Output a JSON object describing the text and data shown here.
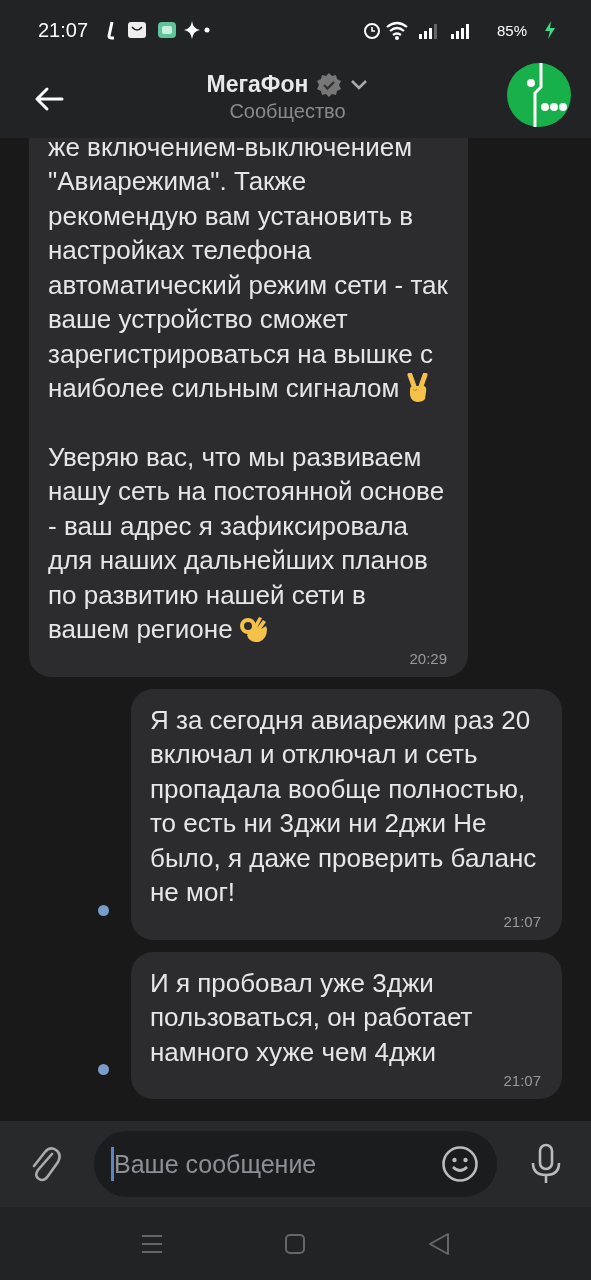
{
  "status_bar": {
    "time": "21:07",
    "battery": "85%"
  },
  "header": {
    "title": "МегаФон",
    "verified": true,
    "subtitle": "Сообщество"
  },
  "messages": [
    {
      "kind": "incoming",
      "unread": false,
      "paragraphs": [
        {
          "text": "же включением-выключением \"Авиарежима\". Также рекомендую вам установить в настройках телефона автоматический режим сети - так ваше устройство сможет зарегистрироваться на вышке с наиболее сильным сигналом",
          "kind": "victory"
        },
        {
          "text": "Уверяю вас, что мы развиваем нашу сеть на постоянной основе - ваш адрес я зафиксировала для наших дальнейших планов по развитию нашей сети в вашем регионе",
          "kind": "ok"
        }
      ],
      "time": "20:29"
    },
    {
      "kind": "outgoing",
      "unread": true,
      "paragraphs": [
        {
          "text": "Я за сегодня авиарежим раз 20 включал и отключал и сеть пропадала вообще полностью, то есть ни 3джи ни 2джи Не было, я даже проверить баланс не мог!"
        }
      ],
      "time": "21:07"
    },
    {
      "kind": "outgoing",
      "unread": true,
      "paragraphs": [
        {
          "text": "И я пробовал уже 3джи пользоваться,  он работает намного хуже чем 4джи"
        }
      ],
      "time": "21:07"
    }
  ],
  "composer": {
    "placeholder": "Ваше сообщение"
  }
}
